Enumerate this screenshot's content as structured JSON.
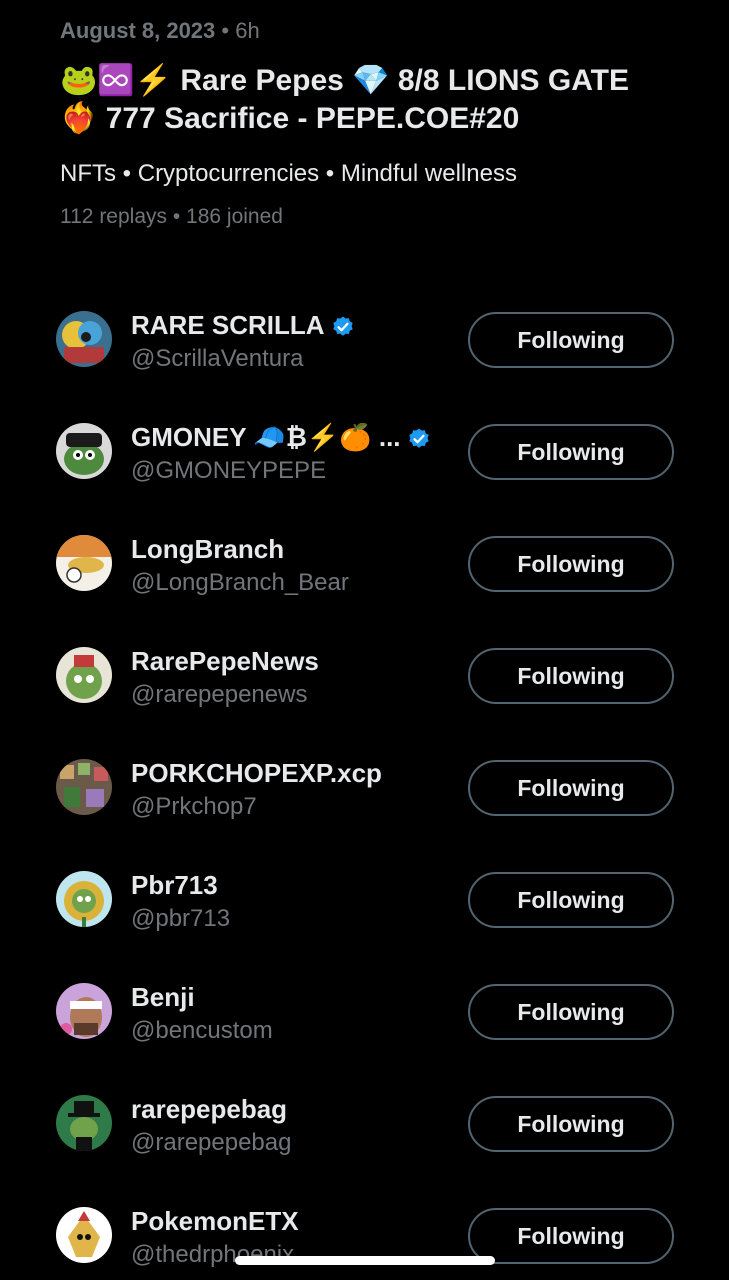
{
  "space": {
    "date": "August 8, 2023",
    "separator": " • ",
    "age": "6h",
    "title": "🐸♾️⚡️ Rare Pepes 💎 8/8 LIONS GATE ❤️‍🔥 777 Sacrifice - PEPE.COE#20",
    "topics": "NFTs • Cryptocurrencies • Mindful wellness",
    "stats": "112 replays • 186 joined"
  },
  "colors": {
    "background": "#000000",
    "primary_text": "#e7e9ea",
    "secondary_text": "#71767b",
    "verified_blue": "#1d9bf0",
    "button_border": "#536471"
  },
  "participants": [
    {
      "name": "RARE SCRILLA",
      "handle": "@ScrillaVentura",
      "verified": true,
      "button": "Following",
      "avatar_icon": "avatar-scrilla"
    },
    {
      "name": "GMONEY 🧢₿⚡️🍊 ...",
      "handle": "@GMONEYPEPE",
      "verified": true,
      "button": "Following",
      "avatar_icon": "avatar-gmoney"
    },
    {
      "name": "LongBranch",
      "handle": "@LongBranch_Bear",
      "verified": false,
      "button": "Following",
      "avatar_icon": "avatar-longbranch"
    },
    {
      "name": "RarePepeNews",
      "handle": "@rarepepenews",
      "verified": false,
      "button": "Following",
      "avatar_icon": "avatar-rarepepenews"
    },
    {
      "name": "PORKCHOPEXP.xcp",
      "handle": "@Prkchop7",
      "verified": false,
      "button": "Following",
      "avatar_icon": "avatar-porkchop"
    },
    {
      "name": "Pbr713",
      "handle": "@pbr713",
      "verified": false,
      "button": "Following",
      "avatar_icon": "avatar-pbr713"
    },
    {
      "name": "Benji",
      "handle": "@bencustom",
      "verified": false,
      "button": "Following",
      "avatar_icon": "avatar-benji"
    },
    {
      "name": "rarepepebag",
      "handle": "@rarepepebag",
      "verified": false,
      "button": "Following",
      "avatar_icon": "avatar-rarepepebag"
    },
    {
      "name": "PokemonETX",
      "handle": "@thedrphoenix",
      "verified": false,
      "button": "Following",
      "avatar_icon": "avatar-pokemonetx"
    }
  ]
}
